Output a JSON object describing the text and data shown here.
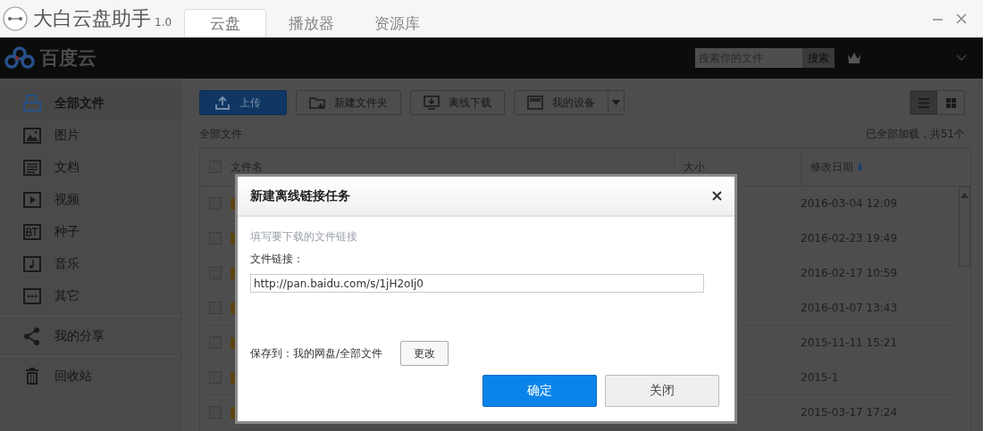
{
  "window": {
    "app_name": "大白云盘助手",
    "version": "1.0"
  },
  "tabs": [
    {
      "label": "云盘",
      "selected": true
    },
    {
      "label": "播放器",
      "selected": false
    },
    {
      "label": "资源库",
      "selected": false
    }
  ],
  "header": {
    "brand": "百度云",
    "search_placeholder": "搜索你的文件",
    "search_button": "搜索"
  },
  "sidebar": {
    "items": [
      {
        "label": "全部文件",
        "selected": true
      },
      {
        "label": "图片",
        "selected": false
      },
      {
        "label": "文档",
        "selected": false
      },
      {
        "label": "视频",
        "selected": false
      },
      {
        "label": "种子",
        "selected": false
      },
      {
        "label": "音乐",
        "selected": false
      },
      {
        "label": "其它",
        "selected": false
      },
      {
        "label": "我的分享",
        "selected": false
      },
      {
        "label": "回收站",
        "selected": false
      }
    ]
  },
  "toolbar": {
    "buttons": [
      {
        "label": "上传",
        "kind": "primary"
      },
      {
        "label": "新建文件夹",
        "kind": "normal"
      },
      {
        "label": "离线下载",
        "kind": "normal"
      },
      {
        "label": "我的设备",
        "kind": "dropdown"
      }
    ],
    "views": [
      {
        "kind": "list",
        "selected": true
      },
      {
        "kind": "grid",
        "selected": false
      }
    ]
  },
  "breadcrumb": "全部文件",
  "load_status": "已全部加载，共51个",
  "table": {
    "select_all_checked": false,
    "columns": [
      "文件名",
      "大小",
      "修改日期"
    ],
    "rows": [
      {
        "checked": false,
        "date": "2016-03-04 12:09"
      },
      {
        "checked": false,
        "date": "2016-02-23 19:49"
      },
      {
        "checked": false,
        "date": "2016-02-17 10:59"
      },
      {
        "checked": false,
        "date": "2016-01-07 13:43"
      },
      {
        "checked": false,
        "date": "2015-11-11 15:21"
      },
      {
        "checked": false,
        "date": "2015-1"
      },
      {
        "checked": false,
        "date": "2015-03-17 17:24"
      }
    ]
  },
  "dialog": {
    "title": "新建离线链接任务",
    "hint": "填写要下载的文件链接",
    "link_label": "文件链接：",
    "link_value": "http://pan.baidu.com/s/1jH2oIj0",
    "save_to": "保存到：我的网盘/全部文件",
    "change_button": "更改",
    "ok_button": "确定",
    "close_button": "关闭"
  }
}
